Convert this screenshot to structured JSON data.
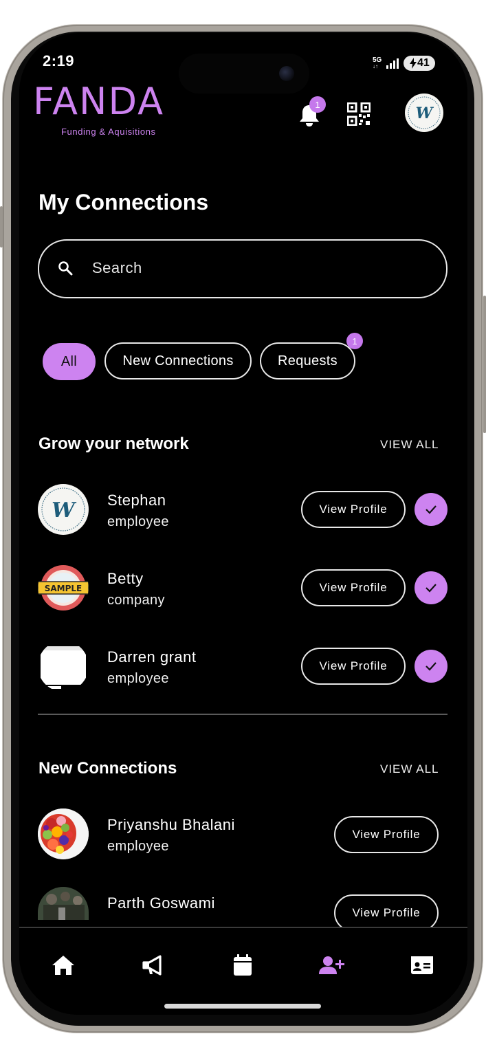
{
  "status": {
    "time": "2:19",
    "network": "5G",
    "battery": "41"
  },
  "header": {
    "logo_text": "FANDA",
    "logo_subtitle": "Funding & Aquisitions",
    "notification_count": "1",
    "profile_logo_letter": "W"
  },
  "page": {
    "title": "My Connections"
  },
  "search": {
    "placeholder": "Search",
    "value": ""
  },
  "filters": {
    "all": "All",
    "new_connections": "New Connections",
    "requests": "Requests",
    "requests_count": "1",
    "selected": "All"
  },
  "grow": {
    "title": "Grow your network",
    "view_all": "VIEW ALL",
    "items": [
      {
        "name": "Stephan",
        "role": "employee",
        "button": "View Profile",
        "avatar": "w-logo"
      },
      {
        "name": "Betty",
        "role": "company",
        "button": "View Profile",
        "avatar": "sample-stamp",
        "avatar_text": "SAMPLE"
      },
      {
        "name": "Darren grant",
        "role": "employee",
        "button": "View Profile",
        "avatar": "blank-window"
      }
    ]
  },
  "new_connections": {
    "title": "New Connections",
    "view_all": "VIEW ALL",
    "items": [
      {
        "name": "Priyanshu Bhalani",
        "role": "employee",
        "button": "View Profile",
        "avatar": "fruit-photo"
      },
      {
        "name": "Parth Goswami",
        "button": "View Profile",
        "avatar": "group-photo"
      }
    ]
  },
  "bottom_nav": {
    "items": [
      "home-icon",
      "megaphone-icon",
      "calendar-icon",
      "add-user-icon",
      "id-card-icon"
    ],
    "active": "add-user-icon"
  },
  "colors": {
    "accent": "#cd83f0",
    "background": "#000000",
    "text": "#ffffff"
  }
}
